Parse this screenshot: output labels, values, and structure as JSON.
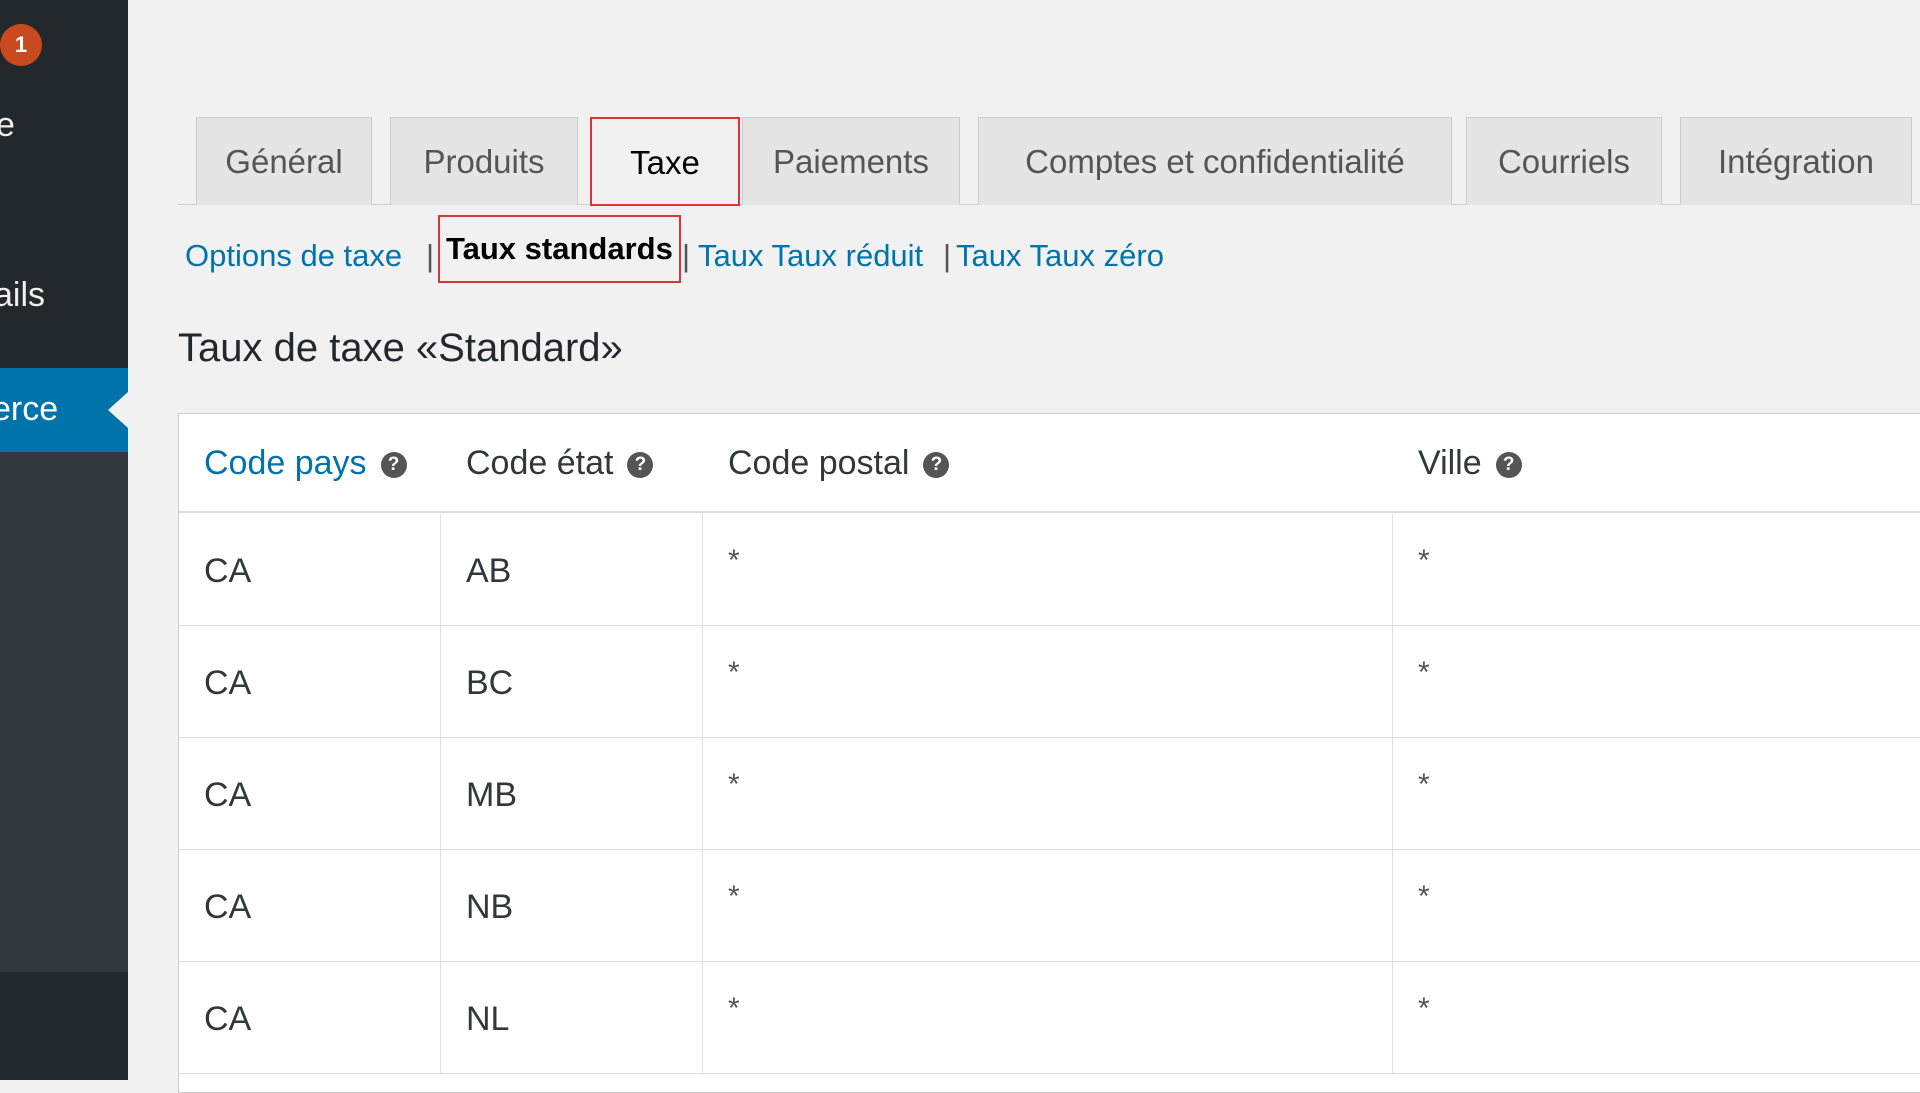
{
  "sidebar": {
    "badge_count": "1",
    "item_partial_1": "e",
    "item_partial_2": "ails",
    "active_item_partial": "erce"
  },
  "tabs": [
    {
      "label": "Général",
      "active": false
    },
    {
      "label": "Produits",
      "active": false
    },
    {
      "label": "Taxe",
      "active": true
    },
    {
      "label": "Paiements",
      "active": false
    },
    {
      "label": "Comptes et confidentialité",
      "active": false
    },
    {
      "label": "Courriels",
      "active": false
    },
    {
      "label": "Intégration",
      "active": false
    }
  ],
  "subnav": {
    "options": "Options de taxe",
    "standard": "Taux standards",
    "reduced": "Taux Taux réduit",
    "zero": "Taux Taux zéro",
    "separator": "|"
  },
  "heading": "Taux de taxe «Standard»",
  "table": {
    "columns": [
      "Code pays",
      "Code état",
      "Code postal",
      "Ville"
    ],
    "help_glyph": "?",
    "rows": [
      {
        "country": "CA",
        "state": "AB",
        "postcode": "*",
        "city": "*"
      },
      {
        "country": "CA",
        "state": "BC",
        "postcode": "*",
        "city": "*"
      },
      {
        "country": "CA",
        "state": "MB",
        "postcode": "*",
        "city": "*"
      },
      {
        "country": "CA",
        "state": "NB",
        "postcode": "*",
        "city": "*"
      },
      {
        "country": "CA",
        "state": "NL",
        "postcode": "*",
        "city": "*"
      }
    ]
  },
  "colors": {
    "sidebar_bg": "#23282d",
    "accent": "#0073aa",
    "highlight_border": "#d63638",
    "badge": "#ca4a1f"
  },
  "icons": {
    "help": "question-circle-icon",
    "sidebar_pointer": "caret-left-icon"
  }
}
